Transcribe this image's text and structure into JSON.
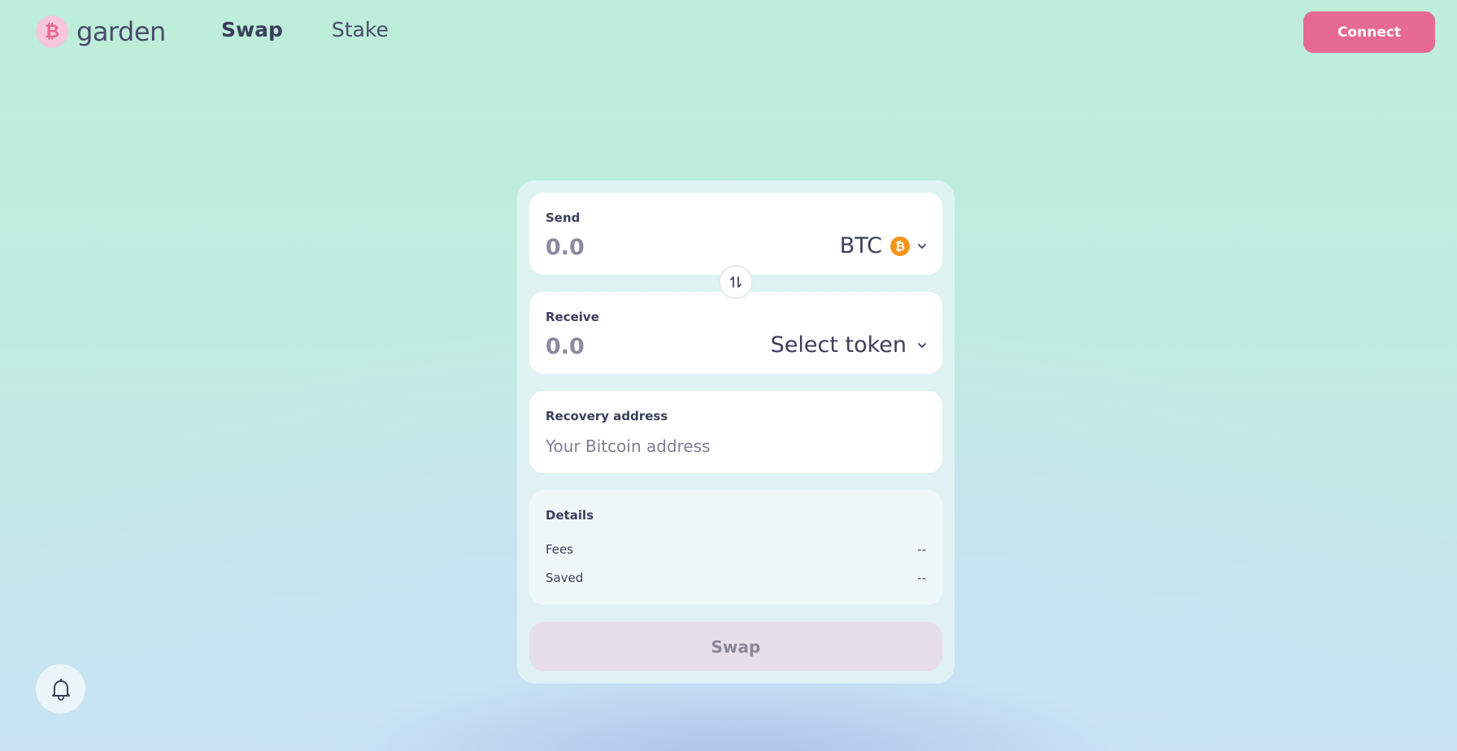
{
  "header": {
    "logo_glyph": "₿",
    "logo_text": "garden",
    "nav": [
      {
        "label": "Swap",
        "active": true
      },
      {
        "label": "Stake",
        "active": false
      }
    ],
    "connect_label": "Connect"
  },
  "swap_card": {
    "send": {
      "label": "Send",
      "amount_placeholder": "0.0",
      "token": "BTC",
      "token_icon": "bitcoin-icon"
    },
    "receive": {
      "label": "Receive",
      "amount_placeholder": "0.0",
      "token": "Select token"
    },
    "recovery": {
      "label": "Recovery address",
      "placeholder": "Your Bitcoin address"
    },
    "details": {
      "title": "Details",
      "rows": [
        {
          "label": "Fees",
          "value": "--"
        },
        {
          "label": "Saved",
          "value": "--"
        }
      ]
    },
    "swap_button": "Swap"
  },
  "colors": {
    "accent": "#e76a93",
    "bitcoin": "#f7931a",
    "swap_button_disabled": "#e6dfeb"
  }
}
